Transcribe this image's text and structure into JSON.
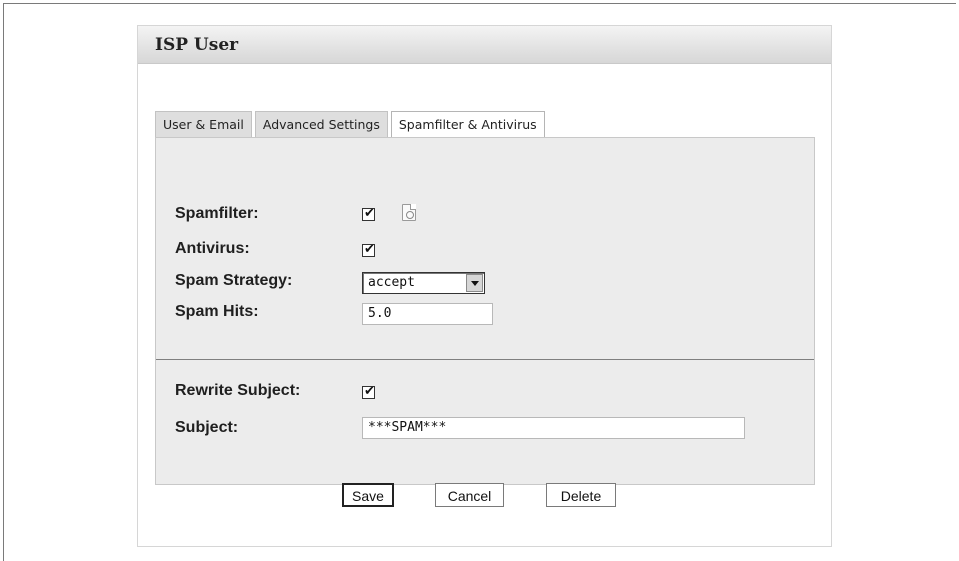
{
  "panel": {
    "title": "ISP User"
  },
  "tabs": [
    {
      "label": "User & Email",
      "active": false
    },
    {
      "label": "Advanced Settings",
      "active": false
    },
    {
      "label": "Spamfilter & Antivirus",
      "active": true
    }
  ],
  "form": {
    "spamfilter": {
      "label": "Spamfilter:",
      "checked": true
    },
    "antivirus": {
      "label": "Antivirus:",
      "checked": true
    },
    "spam_strategy": {
      "label": "Spam Strategy:",
      "value": "accept"
    },
    "spam_hits": {
      "label": "Spam Hits:",
      "value": "5.0"
    },
    "rewrite_subject": {
      "label": "Rewrite Subject:",
      "checked": true
    },
    "subject": {
      "label": "Subject:",
      "value": "***SPAM***"
    }
  },
  "buttons": {
    "save": "Save",
    "cancel": "Cancel",
    "delete": "Delete"
  },
  "icons": {
    "checkmark": "✔",
    "info": "info-icon"
  }
}
